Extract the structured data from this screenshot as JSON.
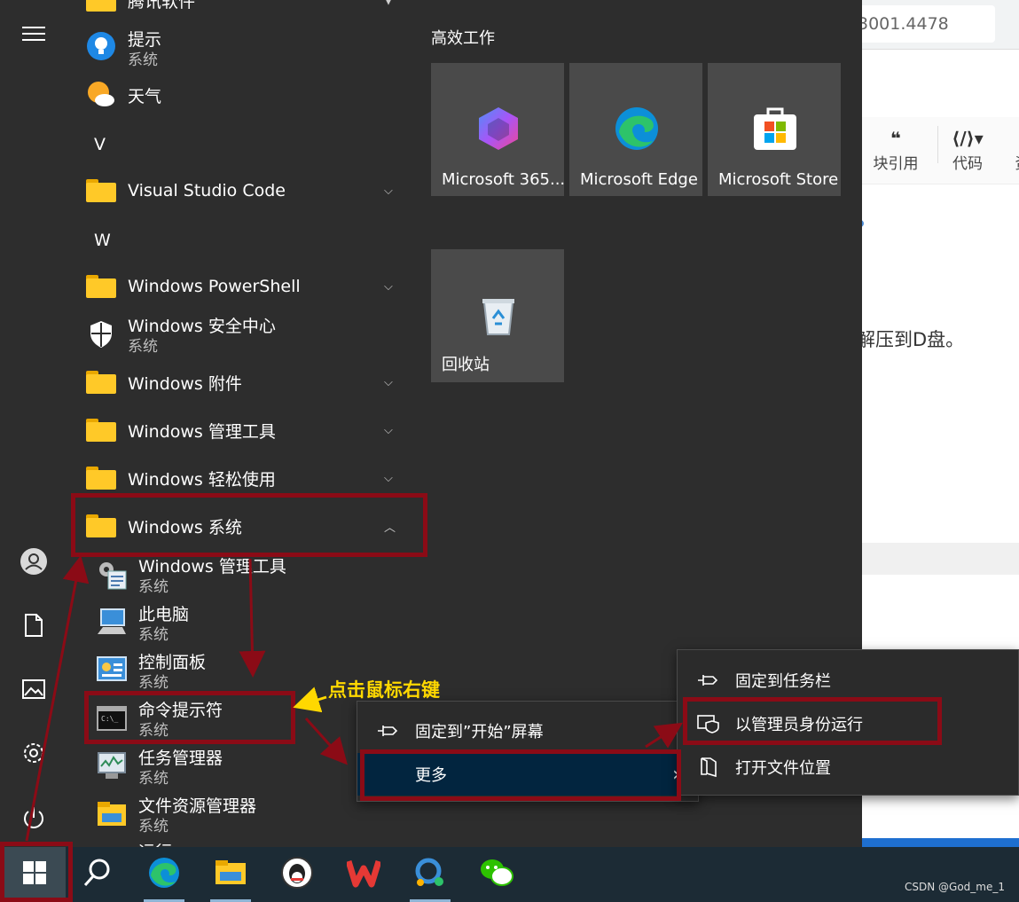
{
  "background_window": {
    "url_fragment": "3001.4478",
    "toolbar": [
      {
        "icon": "quote-icon",
        "label": "块引用"
      },
      {
        "icon": "code-icon",
        "label": "代码"
      },
      {
        "icon": "more-icon",
        "label": "资"
      }
    ],
    "body_text": "解压到D盘。"
  },
  "rail": {
    "items": [
      {
        "icon": "hamburger-icon"
      },
      {
        "icon": "user-icon"
      },
      {
        "icon": "document-icon"
      },
      {
        "icon": "pictures-icon"
      },
      {
        "icon": "settings-icon"
      },
      {
        "icon": "power-icon"
      }
    ]
  },
  "app_list": {
    "items": [
      {
        "type": "folder",
        "label": "腾讯软件",
        "expandable": true
      },
      {
        "type": "app",
        "icon": "tips-icon",
        "label": "提示",
        "sub": "系统"
      },
      {
        "type": "app",
        "icon": "weather-icon",
        "label": "天气"
      },
      {
        "type": "letter",
        "label": "V"
      },
      {
        "type": "folder",
        "label": "Visual Studio Code",
        "expandable": true
      },
      {
        "type": "letter",
        "label": "W"
      },
      {
        "type": "folder",
        "label": "Windows PowerShell",
        "expandable": true
      },
      {
        "type": "app",
        "icon": "shield-icon",
        "label": "Windows 安全中心",
        "sub": "系统"
      },
      {
        "type": "folder",
        "label": "Windows 附件",
        "expandable": true
      },
      {
        "type": "folder",
        "label": "Windows 管理工具",
        "expandable": true
      },
      {
        "type": "folder",
        "label": "Windows 轻松使用",
        "expandable": true
      },
      {
        "type": "folder",
        "label": "Windows 系统",
        "expanded": true
      },
      {
        "type": "subapp",
        "icon": "admin-tools-icon",
        "label": "Windows 管理工具",
        "sub": "系统"
      },
      {
        "type": "subapp",
        "icon": "this-pc-icon",
        "label": "此电脑",
        "sub": "系统"
      },
      {
        "type": "subapp",
        "icon": "control-panel-icon",
        "label": "控制面板",
        "sub": "系统"
      },
      {
        "type": "subapp",
        "icon": "cmd-icon",
        "label": "命令提示符",
        "sub": "系统"
      },
      {
        "type": "subapp",
        "icon": "task-manager-icon",
        "label": "任务管理器",
        "sub": "系统"
      },
      {
        "type": "subapp",
        "icon": "file-explorer-icon",
        "label": "文件资源管理器",
        "sub": "系统"
      },
      {
        "type": "subapp",
        "icon": "run-icon",
        "label": "运行"
      }
    ]
  },
  "tiles": {
    "group_title": "高效工作",
    "items": [
      {
        "label": "Microsoft 365...",
        "icon": "m365-icon"
      },
      {
        "label": "Microsoft Edge",
        "icon": "edge-icon"
      },
      {
        "label": "Microsoft Store",
        "icon": "store-icon"
      },
      {
        "label": "回收站",
        "icon": "recycle-bin-icon"
      }
    ]
  },
  "context_menu": {
    "items": [
      {
        "icon": "pin-icon",
        "label": "固定到”开始”屏幕"
      },
      {
        "label": "更多",
        "arrow": "›",
        "highlighted": true
      }
    ]
  },
  "submenu": {
    "items": [
      {
        "icon": "pin-icon",
        "label": "固定到任务栏"
      },
      {
        "icon": "shield-admin-icon",
        "label": "以管理员身份运行"
      },
      {
        "icon": "open-location-icon",
        "label": "打开文件位置"
      }
    ]
  },
  "annotation": {
    "text": "点击鼠标右键",
    "color": "#ffd800",
    "box_color": "#8b0b16"
  },
  "taskbar": {
    "items": [
      {
        "icon": "windows-start-icon"
      },
      {
        "icon": "search-icon"
      },
      {
        "icon": "edge-icon"
      },
      {
        "icon": "file-explorer-icon"
      },
      {
        "icon": "qq-icon"
      },
      {
        "icon": "wps-icon"
      },
      {
        "icon": "feishu-icon"
      },
      {
        "icon": "wechat-icon"
      }
    ]
  },
  "watermark": "CSDN @God_me_1"
}
